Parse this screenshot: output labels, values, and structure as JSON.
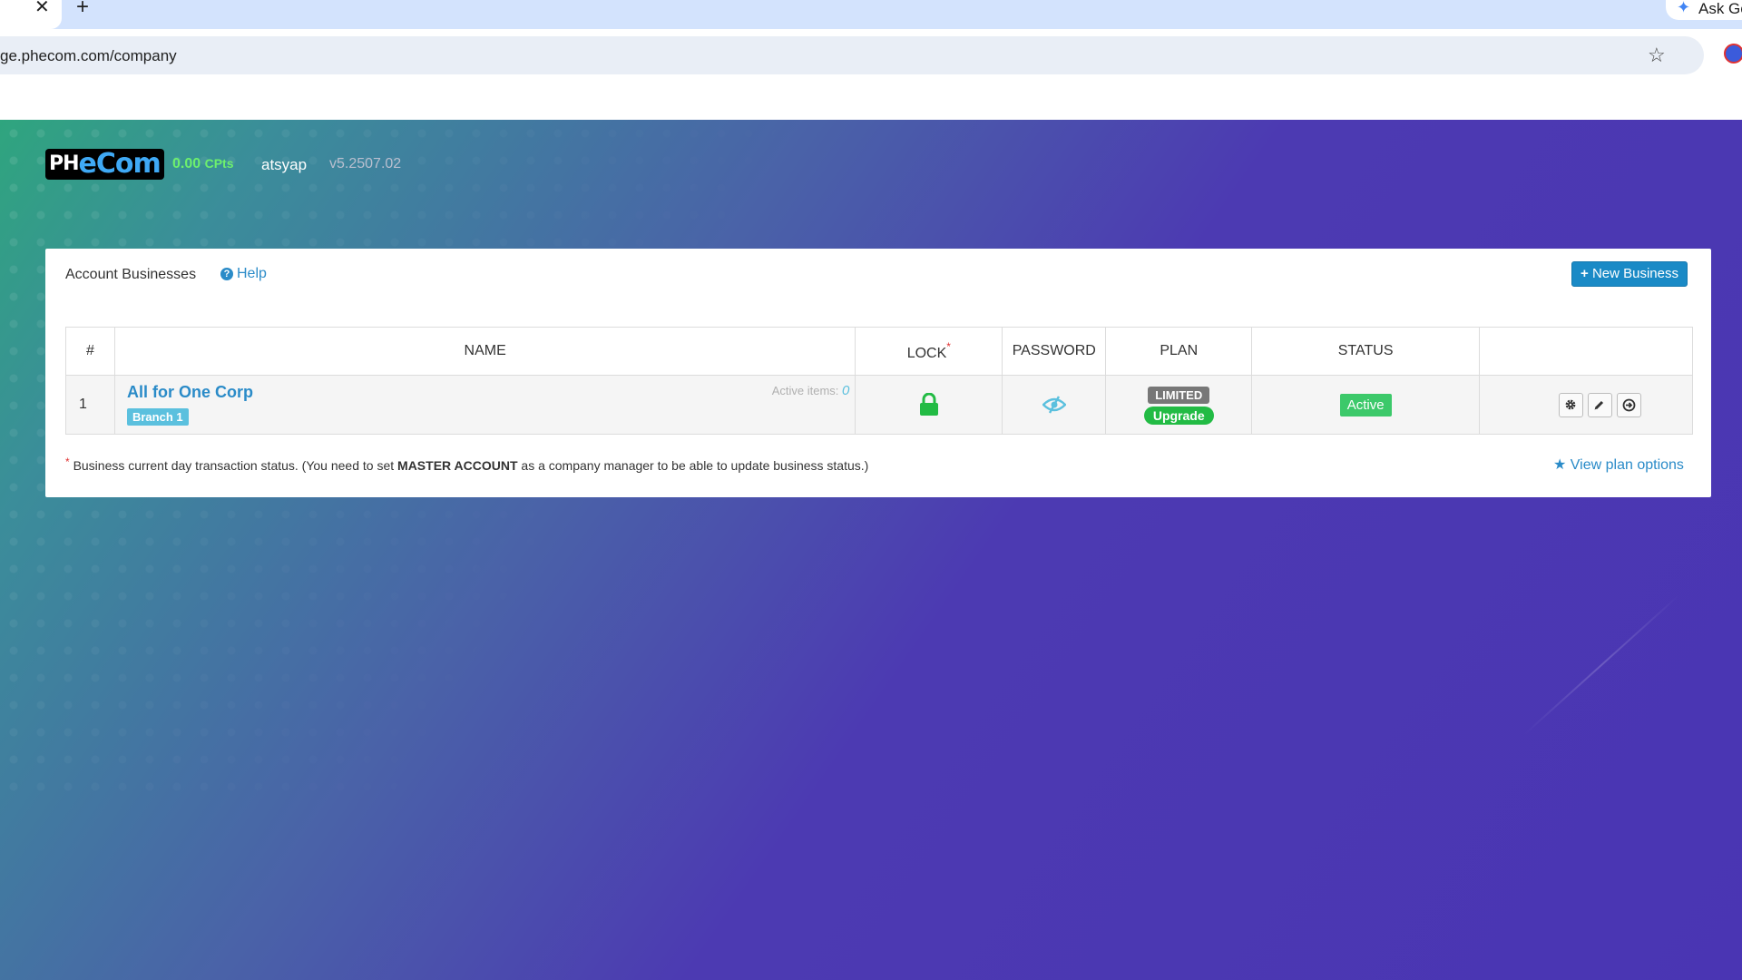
{
  "browser": {
    "tab_close_glyph": "✕",
    "new_tab_glyph": "+",
    "ask_gemini_label": "Ask Ge",
    "url": "ge.phecom.com/company",
    "star_glyph": "☆"
  },
  "header": {
    "logo_part1": "PH",
    "logo_part2": "eCom",
    "cpts_value": "0.00",
    "cpts_unit": "CPts",
    "username": "atsyap",
    "version": "v5.2507.02"
  },
  "panel": {
    "title": "Account Businesses",
    "help_label": "Help",
    "new_business_label": "New Business",
    "columns": {
      "index": "#",
      "name": "NAME",
      "lock": "LOCK",
      "password": "PASSWORD",
      "plan": "PLAN",
      "status": "STATUS"
    },
    "rows": [
      {
        "index": "1",
        "name": "All for One Corp",
        "branch": "Branch 1",
        "active_items_label": "Active items:",
        "active_items_count": "0",
        "plan_badge": "LIMITED",
        "upgrade_label": "Upgrade",
        "status": "Active"
      }
    ],
    "footnote_pre": "Business current day transaction status. (You need to set ",
    "footnote_bold": "MASTER ACCOUNT",
    "footnote_post": " as a company manager to be able to update business status.)",
    "view_plan_label": "View plan options"
  },
  "colors": {
    "link": "#2a8bc8",
    "primary_button": "#1a8ac6",
    "status_active": "#3cc96a",
    "upgrade": "#22bb44",
    "lock_green": "#22bb44",
    "cpts_green": "#6df06d"
  }
}
